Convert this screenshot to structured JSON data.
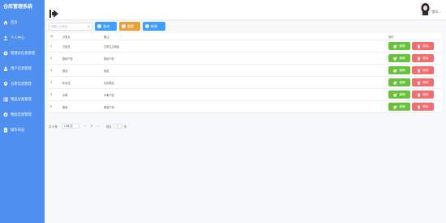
{
  "app": {
    "title": "仓库管理系统"
  },
  "sidebar": {
    "items": [
      {
        "label": "首页",
        "icon": "home-icon"
      },
      {
        "label": "个人中心",
        "icon": "user-icon"
      },
      {
        "label": "管理员信息管理",
        "icon": "gear-icon"
      },
      {
        "label": "用户信息管理",
        "icon": "users-icon"
      },
      {
        "label": "仓库信息管理",
        "icon": "location-icon"
      },
      {
        "label": "物品分类管理",
        "icon": "list-icon"
      },
      {
        "label": "物品信息管理",
        "icon": "box-icon"
      },
      {
        "label": "操作日志",
        "icon": "log-icon"
      }
    ]
  },
  "header": {
    "user_name": "张三",
    "caret": "⌄"
  },
  "toolbar": {
    "search_placeholder": "请输入分类名",
    "clear_glyph": "⊗",
    "query_label": "查询",
    "reset_label": "重置",
    "add_label": "新增"
  },
  "table": {
    "columns": [
      "ID",
      "分类名",
      "备注",
      "操作"
    ],
    "rows": [
      {
        "id": "1",
        "name": "日用品",
        "remark": "日常生活用品"
      },
      {
        "id": "2",
        "name": "数码产品",
        "remark": "数码产品"
      },
      {
        "id": "3",
        "name": "食品",
        "remark": "食品"
      },
      {
        "id": "4",
        "name": "化妆品",
        "remark": "化妆美容"
      },
      {
        "id": "5",
        "name": "水果",
        "remark": "水果产品"
      },
      {
        "id": "6",
        "name": "服装",
        "remark": "服装产品"
      }
    ],
    "edit_label": "编辑",
    "delete_label": "删除"
  },
  "pager": {
    "total": "共 6 条",
    "page_size": "10条/页",
    "prev": "<",
    "current": "1",
    "next": ">",
    "goto_label": "前往",
    "goto_value": "1",
    "page_unit": "页"
  },
  "colors": {
    "sidebar": "#4f8ff0",
    "primary": "#409eff",
    "warning": "#e6a23c",
    "success": "#67c23a",
    "danger": "#f56c6c"
  }
}
